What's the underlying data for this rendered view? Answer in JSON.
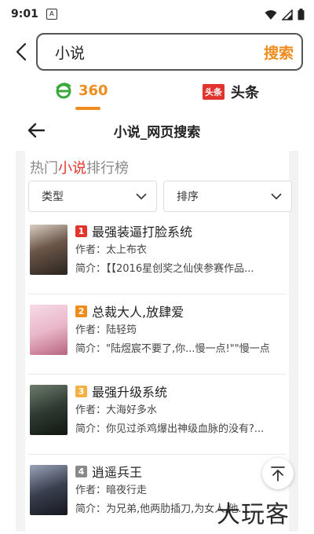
{
  "status": {
    "time": "9:01",
    "sim_glyph": "A"
  },
  "search": {
    "query": "小说",
    "button_label": "搜索"
  },
  "engines": [
    {
      "name": "360",
      "active": true
    },
    {
      "name": "头条",
      "logo_text": "头条",
      "active": false
    }
  ],
  "webview": {
    "title": "小说_网页搜索"
  },
  "ranking": {
    "title_prefix": "热门",
    "title_highlight": "小说",
    "title_suffix": "排行榜",
    "filters": {
      "type_label": "类型",
      "sort_label": "排序"
    },
    "author_key": "作者：",
    "intro_key": "简介：",
    "books": [
      {
        "rank": "1",
        "title": "最强装逼打脸系统",
        "author": "太上布衣",
        "intro": "【【2016星创奖之仙侠参赛作品...",
        "badge_color": "#e0342c",
        "cover_color": "#6b5548"
      },
      {
        "rank": "2",
        "title": "总裁大人,放肆爱",
        "author": "陆轻筠",
        "intro": "\"陆煜宸不要了,你...慢一点!\"\"慢一点",
        "badge_color": "#f08c1e",
        "cover_color": "#e9b7c9"
      },
      {
        "rank": "3",
        "title": "最强升级系统",
        "author": "大海好多水",
        "intro": "你见过杀鸡爆出神级血脉的没有?...",
        "badge_color": "#f5b043",
        "cover_color": "#2f3a32"
      },
      {
        "rank": "4",
        "title": "逍遥兵王",
        "author": "暗夜行走",
        "intro": "为兄弟,他两肋插刀,为女人,他...",
        "badge_color": "#8a8a8a",
        "cover_color": "#3a3f4f"
      }
    ]
  },
  "watermark": "大玩客",
  "colors": {
    "accent": "#f08c1e",
    "red": "#e0342c"
  }
}
